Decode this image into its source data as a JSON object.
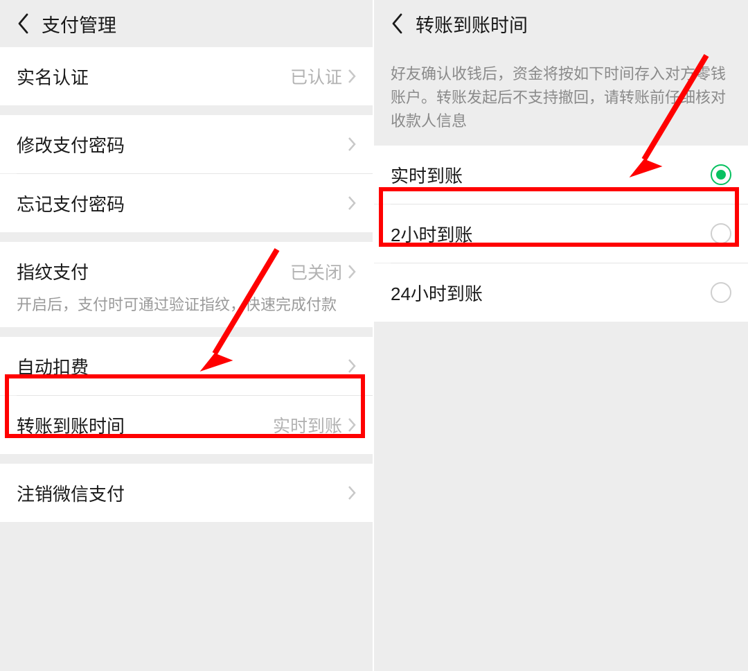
{
  "left": {
    "header_title": "支付管理",
    "rows": {
      "real_name": {
        "label": "实名认证",
        "value": "已认证"
      },
      "change_pwd": {
        "label": "修改支付密码"
      },
      "forgot_pwd": {
        "label": "忘记支付密码"
      },
      "fingerprint": {
        "label": "指纹支付",
        "value": "已关闭",
        "hint": "开启后，支付时可通过验证指纹，快速完成付款"
      },
      "auto_deduct": {
        "label": "自动扣费"
      },
      "transfer_time": {
        "label": "转账到账时间",
        "value": "实时到账"
      },
      "deregister": {
        "label": "注销微信支付"
      }
    }
  },
  "right": {
    "header_title": "转账到账时间",
    "description": "好友确认收钱后，资金将按如下时间存入对方零钱账户。转账发起后不支持撤回，请转账前仔细核对收款人信息",
    "options": {
      "instant": {
        "label": "实时到账",
        "selected": true
      },
      "two_hours": {
        "label": "2小时到账",
        "selected": false
      },
      "twenty_four_hours": {
        "label": "24小时到账",
        "selected": false
      }
    }
  }
}
